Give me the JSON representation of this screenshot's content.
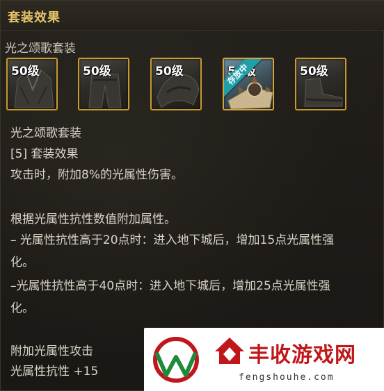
{
  "header": {
    "title": "套装效果"
  },
  "set": {
    "name": "光之颂歌套装"
  },
  "items": [
    {
      "level": "50级",
      "icon": "armor-top-icon"
    },
    {
      "level": "50级",
      "icon": "armor-pants-icon"
    },
    {
      "level": "50级",
      "icon": "armor-shoulder-icon"
    },
    {
      "level": "50级",
      "icon": "relic-icon",
      "ribbon": "存放中"
    },
    {
      "level": "50级",
      "icon": "armor-shoes-icon"
    }
  ],
  "description": {
    "set_title": "光之颂歌套装",
    "set_bonus_header": "[5] 套装效果",
    "line1": "攻击时，附加8%的光属性伤害。",
    "line2": "根据光属性抗性数值附加属性。",
    "line3a": "– 光属性抗性高于20点时：进入地下城后，增加15点光属性强",
    "line3b": "化。",
    "line4a": "–光属性抗性高于40点时：进入地下城后，增加25点光属性强",
    "line4b": "化。",
    "line5": "附加光属性攻击",
    "line6": "光属性抗性 +15"
  },
  "watermark": {
    "name": "丰收游戏网",
    "domain": "fengshouhe.com",
    "brand_color": "#c0171b"
  }
}
